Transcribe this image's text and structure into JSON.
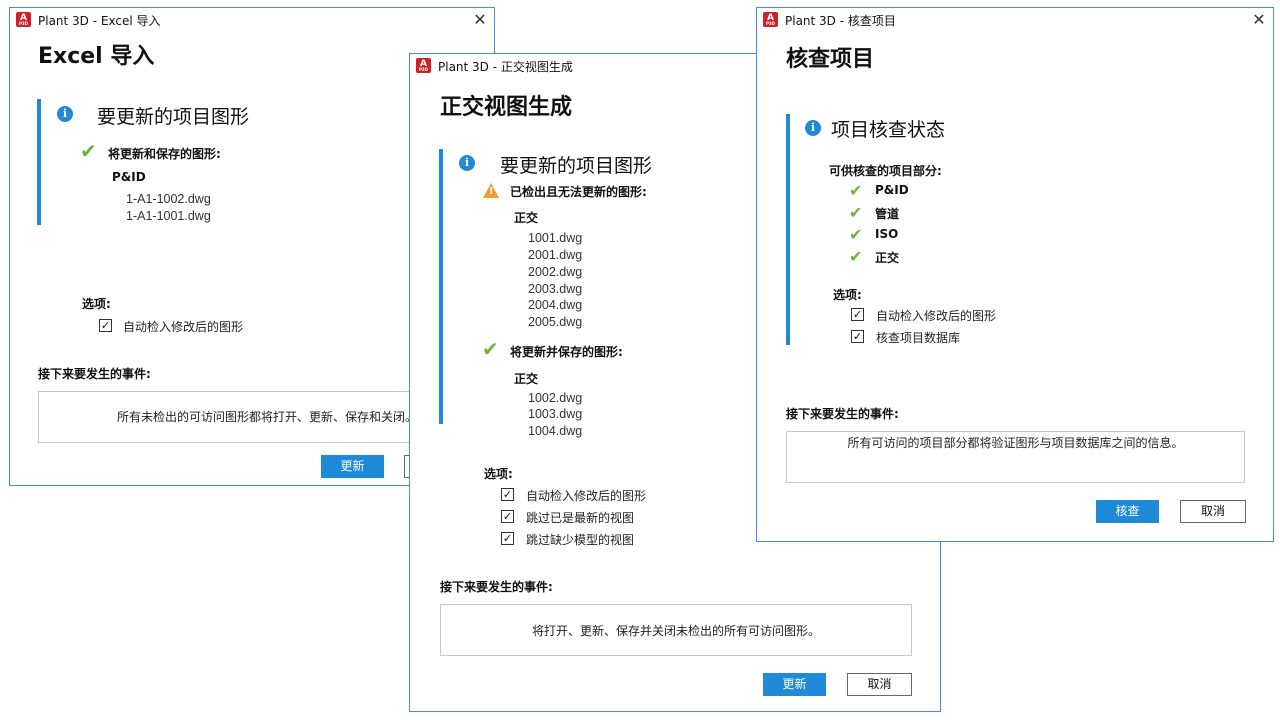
{
  "colors": {
    "accent": "#1f8ad8",
    "check": "#6db33f",
    "warning": "#f0a030",
    "app_icon": "#d0202a"
  },
  "app_icon": {
    "letter": "A",
    "sub": "P3D"
  },
  "excel_dialog": {
    "window_title": "Plant 3D - Excel 导入",
    "title": "Excel 导入",
    "section_heading": "要更新的项目图形",
    "save_label": "将更新和保存的图形:",
    "group": "P&ID",
    "files": [
      "1-A1-1002.dwg",
      "1-A1-1001.dwg"
    ],
    "options_label": "选项:",
    "options": [
      {
        "label": "自动检入修改后的图形",
        "checked": true
      }
    ],
    "events_label": "接下来要发生的事件:",
    "events_text": "所有未检出的可访问图形都将打开、更新、保存和关闭。",
    "update_button": "更新"
  },
  "ortho_dialog": {
    "window_title": "Plant 3D - 正交视图生成",
    "title": "正交视图生成",
    "section_heading": "要更新的项目图形",
    "warning_label": "已检出且无法更新的图形:",
    "warning_group": "正交",
    "warning_files": [
      "1001.dwg",
      "2001.dwg",
      "2002.dwg",
      "2003.dwg",
      "2004.dwg",
      "2005.dwg"
    ],
    "save_label": "将更新并保存的图形:",
    "save_group": "正交",
    "save_files": [
      "1002.dwg",
      "1003.dwg",
      "1004.dwg"
    ],
    "options_label": "选项:",
    "options": [
      {
        "label": "自动检入修改后的图形",
        "checked": true
      },
      {
        "label": "跳过已是最新的视图",
        "checked": true
      },
      {
        "label": "跳过缺少模型的视图",
        "checked": true
      }
    ],
    "events_label": "接下来要发生的事件:",
    "events_text": "将打开、更新、保存并关闭未检出的所有可访问图形。",
    "update_button": "更新",
    "cancel_button": "取消"
  },
  "audit_dialog": {
    "window_title": "Plant 3D - 核查项目",
    "title": "核查项目",
    "section_heading": "项目核查状态",
    "parts_label": "可供核查的项目部分:",
    "parts": [
      "P&ID",
      "管道",
      "ISO",
      "正交"
    ],
    "options_label": "选项:",
    "options": [
      {
        "label": "自动检入修改后的图形",
        "checked": true
      },
      {
        "label": "核查项目数据库",
        "checked": true
      }
    ],
    "events_label": "接下来要发生的事件:",
    "events_text": "所有可访问的项目部分都将验证图形与项目数据库之间的信息。",
    "audit_button": "核查",
    "cancel_button": "取消"
  }
}
